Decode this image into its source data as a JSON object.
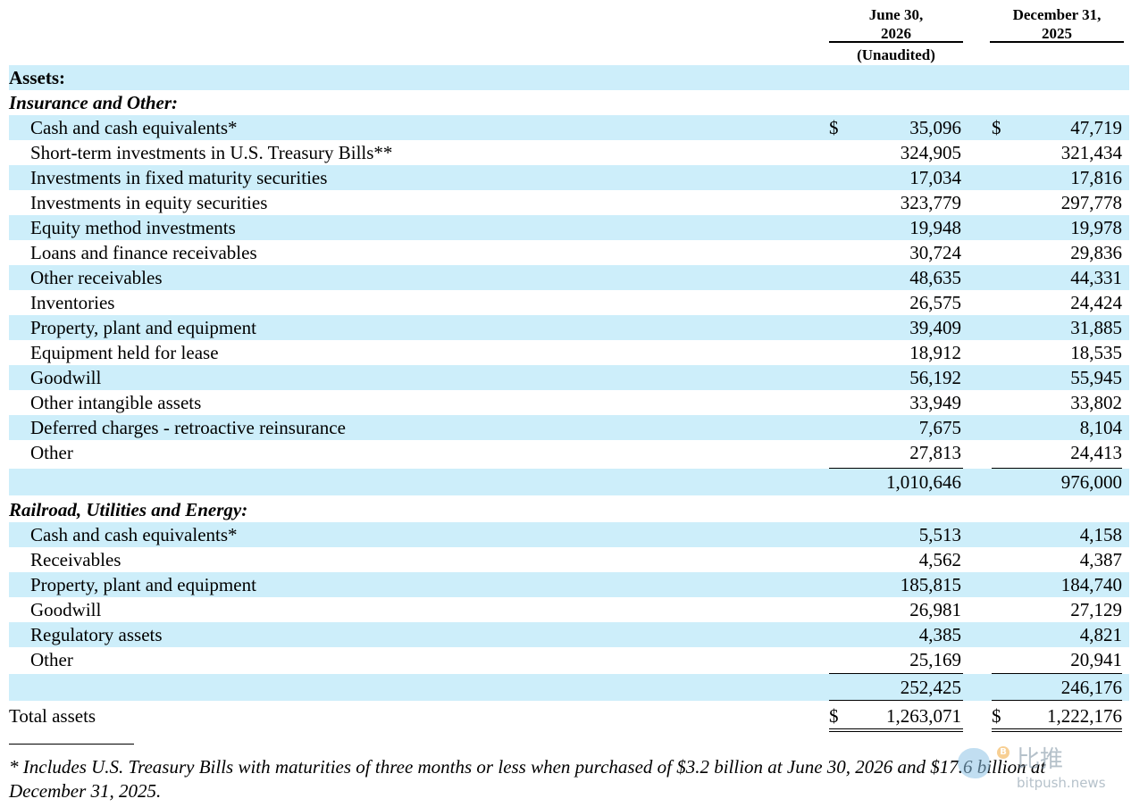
{
  "header": {
    "col1_date": "June 30,",
    "col1_year": "2026",
    "col1_note": "(Unaudited)",
    "col2_date": "December 31,",
    "col2_year": "2025"
  },
  "assets_heading": "Assets:",
  "insurance": {
    "heading": "Insurance and Other:",
    "currency_symbol": "$",
    "items": [
      {
        "label": "Cash and cash equivalents*",
        "v2026": "35,096",
        "v2025": "47,719"
      },
      {
        "label": "Short-term investments in U.S. Treasury Bills**",
        "v2026": "324,905",
        "v2025": "321,434"
      },
      {
        "label": "Investments in fixed maturity securities",
        "v2026": "17,034",
        "v2025": "17,816"
      },
      {
        "label": "Investments in equity securities",
        "v2026": "323,779",
        "v2025": "297,778"
      },
      {
        "label": "Equity method investments",
        "v2026": "19,948",
        "v2025": "19,978"
      },
      {
        "label": "Loans and finance receivables",
        "v2026": "30,724",
        "v2025": "29,836"
      },
      {
        "label": "Other receivables",
        "v2026": "48,635",
        "v2025": "44,331"
      },
      {
        "label": "Inventories",
        "v2026": "26,575",
        "v2025": "24,424"
      },
      {
        "label": "Property, plant and equipment",
        "v2026": "39,409",
        "v2025": "31,885"
      },
      {
        "label": "Equipment held for lease",
        "v2026": "18,912",
        "v2025": "18,535"
      },
      {
        "label": "Goodwill",
        "v2026": "56,192",
        "v2025": "55,945"
      },
      {
        "label": "Other intangible assets",
        "v2026": "33,949",
        "v2025": "33,802"
      },
      {
        "label": "Deferred charges - retroactive reinsurance",
        "v2026": "7,675",
        "v2025": "8,104"
      },
      {
        "label": "Other",
        "v2026": "27,813",
        "v2025": "24,413"
      }
    ],
    "subtotal_2026": "1,010,646",
    "subtotal_2025": "976,000"
  },
  "railroad": {
    "heading": "Railroad, Utilities and Energy:",
    "items": [
      {
        "label": "Cash and cash equivalents*",
        "v2026": "5,513",
        "v2025": "4,158"
      },
      {
        "label": "Receivables",
        "v2026": "4,562",
        "v2025": "4,387"
      },
      {
        "label": "Property, plant and equipment",
        "v2026": "185,815",
        "v2025": "184,740"
      },
      {
        "label": "Goodwill",
        "v2026": "26,981",
        "v2025": "27,129"
      },
      {
        "label": "Regulatory assets",
        "v2026": "4,385",
        "v2025": "4,821"
      },
      {
        "label": "Other",
        "v2026": "25,169",
        "v2025": "20,941"
      }
    ],
    "subtotal_2026": "252,425",
    "subtotal_2025": "246,176"
  },
  "total": {
    "label": "Total assets",
    "currency_symbol": "$",
    "v2026": "1,263,071",
    "v2025": "1,222,176"
  },
  "footnote": "* Includes U.S. Treasury Bills with maturities of three months or less when purchased of $3.2 billion at June 30, 2026 and $17.6 billion at December 31, 2025.",
  "watermark": {
    "coin_symbol": "B",
    "chinese_text": "比推",
    "url_text": "bitpush.news"
  },
  "colors": {
    "shade": "#cdeefa",
    "text": "#000000"
  }
}
